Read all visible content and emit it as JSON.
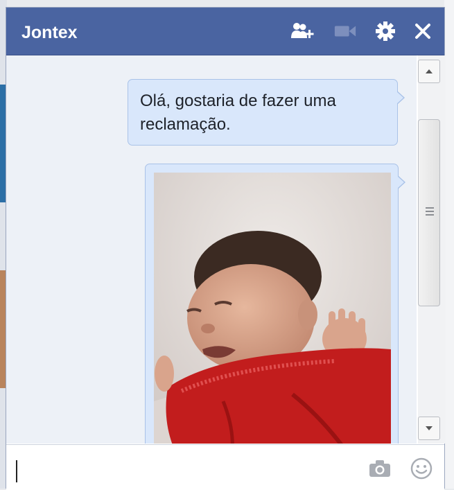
{
  "chat": {
    "title": "Jontex",
    "header_icons": [
      "add-friend-icon",
      "video-call-icon",
      "gear-icon",
      "close-icon"
    ],
    "input_placeholder": ""
  },
  "messages": [
    {
      "type": "text",
      "text": "Olá, gostaria de fazer uma reclamação."
    },
    {
      "type": "photo",
      "description": "baby-photo"
    }
  ],
  "colors": {
    "titlebar": "#4a64a1",
    "bubble": "#d9e7fb",
    "bubble_border": "#a9c2e8",
    "messages_bg": "#edf1f7"
  }
}
